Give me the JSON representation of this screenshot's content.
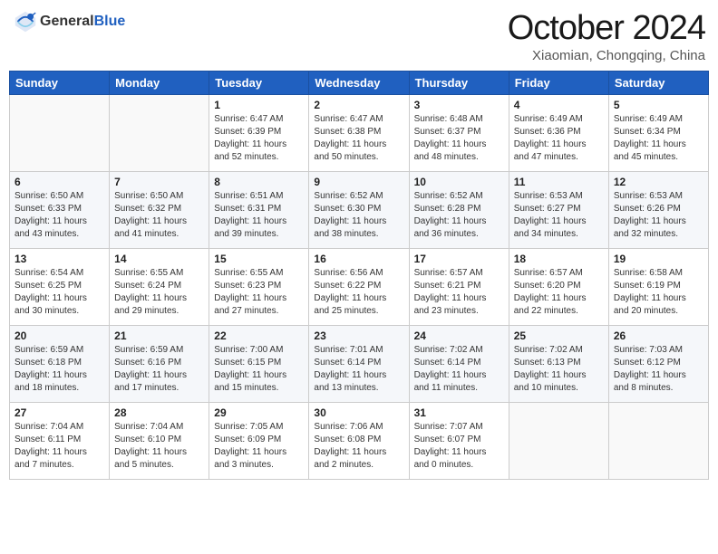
{
  "header": {
    "logo_general": "General",
    "logo_blue": "Blue",
    "month": "October 2024",
    "location": "Xiaomian, Chongqing, China"
  },
  "weekdays": [
    "Sunday",
    "Monday",
    "Tuesday",
    "Wednesday",
    "Thursday",
    "Friday",
    "Saturday"
  ],
  "weeks": [
    [
      {
        "day": "",
        "content": ""
      },
      {
        "day": "",
        "content": ""
      },
      {
        "day": "1",
        "content": "Sunrise: 6:47 AM\nSunset: 6:39 PM\nDaylight: 11 hours and 52 minutes."
      },
      {
        "day": "2",
        "content": "Sunrise: 6:47 AM\nSunset: 6:38 PM\nDaylight: 11 hours and 50 minutes."
      },
      {
        "day": "3",
        "content": "Sunrise: 6:48 AM\nSunset: 6:37 PM\nDaylight: 11 hours and 48 minutes."
      },
      {
        "day": "4",
        "content": "Sunrise: 6:49 AM\nSunset: 6:36 PM\nDaylight: 11 hours and 47 minutes."
      },
      {
        "day": "5",
        "content": "Sunrise: 6:49 AM\nSunset: 6:34 PM\nDaylight: 11 hours and 45 minutes."
      }
    ],
    [
      {
        "day": "6",
        "content": "Sunrise: 6:50 AM\nSunset: 6:33 PM\nDaylight: 11 hours and 43 minutes."
      },
      {
        "day": "7",
        "content": "Sunrise: 6:50 AM\nSunset: 6:32 PM\nDaylight: 11 hours and 41 minutes."
      },
      {
        "day": "8",
        "content": "Sunrise: 6:51 AM\nSunset: 6:31 PM\nDaylight: 11 hours and 39 minutes."
      },
      {
        "day": "9",
        "content": "Sunrise: 6:52 AM\nSunset: 6:30 PM\nDaylight: 11 hours and 38 minutes."
      },
      {
        "day": "10",
        "content": "Sunrise: 6:52 AM\nSunset: 6:28 PM\nDaylight: 11 hours and 36 minutes."
      },
      {
        "day": "11",
        "content": "Sunrise: 6:53 AM\nSunset: 6:27 PM\nDaylight: 11 hours and 34 minutes."
      },
      {
        "day": "12",
        "content": "Sunrise: 6:53 AM\nSunset: 6:26 PM\nDaylight: 11 hours and 32 minutes."
      }
    ],
    [
      {
        "day": "13",
        "content": "Sunrise: 6:54 AM\nSunset: 6:25 PM\nDaylight: 11 hours and 30 minutes."
      },
      {
        "day": "14",
        "content": "Sunrise: 6:55 AM\nSunset: 6:24 PM\nDaylight: 11 hours and 29 minutes."
      },
      {
        "day": "15",
        "content": "Sunrise: 6:55 AM\nSunset: 6:23 PM\nDaylight: 11 hours and 27 minutes."
      },
      {
        "day": "16",
        "content": "Sunrise: 6:56 AM\nSunset: 6:22 PM\nDaylight: 11 hours and 25 minutes."
      },
      {
        "day": "17",
        "content": "Sunrise: 6:57 AM\nSunset: 6:21 PM\nDaylight: 11 hours and 23 minutes."
      },
      {
        "day": "18",
        "content": "Sunrise: 6:57 AM\nSunset: 6:20 PM\nDaylight: 11 hours and 22 minutes."
      },
      {
        "day": "19",
        "content": "Sunrise: 6:58 AM\nSunset: 6:19 PM\nDaylight: 11 hours and 20 minutes."
      }
    ],
    [
      {
        "day": "20",
        "content": "Sunrise: 6:59 AM\nSunset: 6:18 PM\nDaylight: 11 hours and 18 minutes."
      },
      {
        "day": "21",
        "content": "Sunrise: 6:59 AM\nSunset: 6:16 PM\nDaylight: 11 hours and 17 minutes."
      },
      {
        "day": "22",
        "content": "Sunrise: 7:00 AM\nSunset: 6:15 PM\nDaylight: 11 hours and 15 minutes."
      },
      {
        "day": "23",
        "content": "Sunrise: 7:01 AM\nSunset: 6:14 PM\nDaylight: 11 hours and 13 minutes."
      },
      {
        "day": "24",
        "content": "Sunrise: 7:02 AM\nSunset: 6:14 PM\nDaylight: 11 hours and 11 minutes."
      },
      {
        "day": "25",
        "content": "Sunrise: 7:02 AM\nSunset: 6:13 PM\nDaylight: 11 hours and 10 minutes."
      },
      {
        "day": "26",
        "content": "Sunrise: 7:03 AM\nSunset: 6:12 PM\nDaylight: 11 hours and 8 minutes."
      }
    ],
    [
      {
        "day": "27",
        "content": "Sunrise: 7:04 AM\nSunset: 6:11 PM\nDaylight: 11 hours and 7 minutes."
      },
      {
        "day": "28",
        "content": "Sunrise: 7:04 AM\nSunset: 6:10 PM\nDaylight: 11 hours and 5 minutes."
      },
      {
        "day": "29",
        "content": "Sunrise: 7:05 AM\nSunset: 6:09 PM\nDaylight: 11 hours and 3 minutes."
      },
      {
        "day": "30",
        "content": "Sunrise: 7:06 AM\nSunset: 6:08 PM\nDaylight: 11 hours and 2 minutes."
      },
      {
        "day": "31",
        "content": "Sunrise: 7:07 AM\nSunset: 6:07 PM\nDaylight: 11 hours and 0 minutes."
      },
      {
        "day": "",
        "content": ""
      },
      {
        "day": "",
        "content": ""
      }
    ]
  ]
}
